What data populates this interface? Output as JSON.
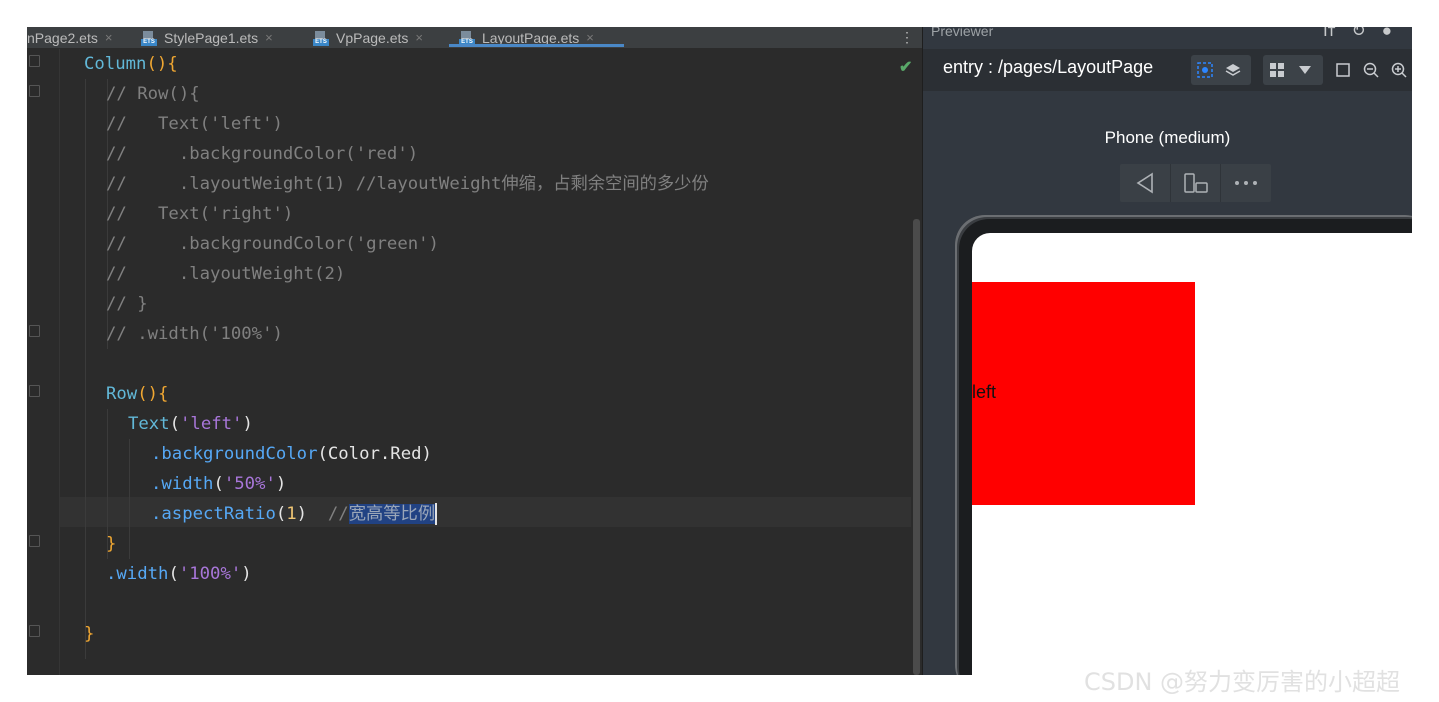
{
  "tabs": [
    {
      "label": "nPage2.ets",
      "active": false
    },
    {
      "label": "StylePage1.ets",
      "active": false
    },
    {
      "label": "VpPage.ets",
      "active": false
    },
    {
      "label": "LayoutPage.ets",
      "active": true
    }
  ],
  "tab_close_glyph": "×",
  "tab_icon_text": "ETS",
  "tab_menu_glyph": "⋮",
  "inspection_status_icon": "check-icon",
  "code": {
    "l1_fn": "Column",
    "l1_brace": "(){",
    "l2": "// Row(){",
    "l3": "//   Text('left')",
    "l4": "//     .backgroundColor('red')",
    "l5": "//     .layoutWeight(1) //layoutWeight伸缩，占剩余空间的多少份",
    "l6": "//   Text('right')",
    "l7": "//     .backgroundColor('green')",
    "l8": "//     .layoutWeight(2)",
    "l9": "// }",
    "l10": "// .width('100%')",
    "l12_fn": "Row",
    "l12_brace": "(){",
    "l13_fn": "Text",
    "l13_open": "(",
    "l13_str": "'left'",
    "l13_close": ")",
    "l14_fn": ".backgroundColor",
    "l14_open": "(",
    "l14_arg": "Color.Red",
    "l14_close": ")",
    "l15_fn": ".width",
    "l15_open": "(",
    "l15_str": "'50%'",
    "l15_close": ")",
    "l16_fn": ".aspectRatio",
    "l16_open": "(",
    "l16_num": "1",
    "l16_close": ")",
    "l16_gap": "  ",
    "l16_cmt": "//",
    "l16_sel": "宽高等比例",
    "l17": "}",
    "l18_fn": ".width",
    "l18_open": "(",
    "l18_str": "'100%'",
    "l18_close": ")",
    "l20": "}"
  },
  "previewer": {
    "title": "Previewer",
    "route": "entry : /pages/LayoutPage",
    "device": "Phone (medium)",
    "toolbar_icons": [
      "inspector-icon",
      "layers-icon",
      "grid-icon",
      "dropdown-icon",
      "fit-icon",
      "zoom-out-icon",
      "zoom-in-icon"
    ],
    "device_controls": [
      "back-icon",
      "rotate-icon",
      "more-icon"
    ],
    "preview_text": "left",
    "box_color": "#ff0000"
  },
  "watermark": "CSDN @努力变厉害的小超超"
}
